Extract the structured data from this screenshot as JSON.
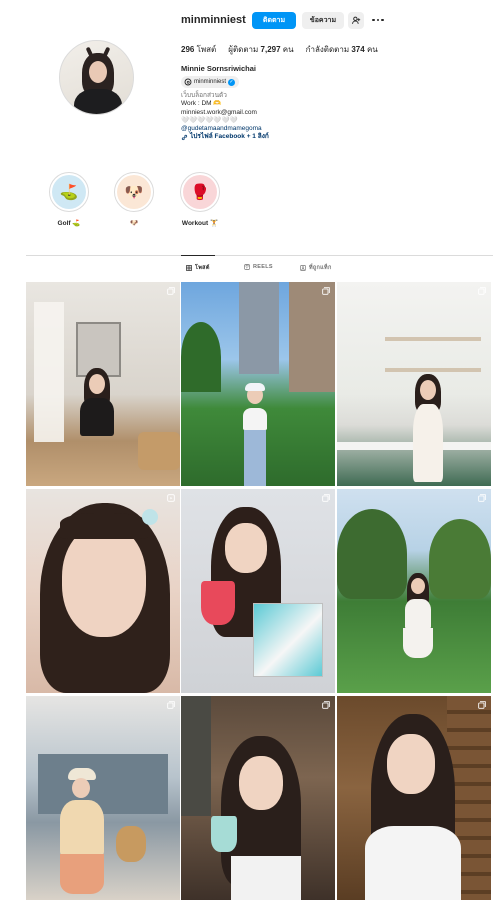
{
  "profile": {
    "username": "minminniest",
    "follow_label": "ติดตาม",
    "message_label": "ข้อความ",
    "posts_count": "296",
    "posts_label": "โพสต์",
    "followers_label": "ผู้ติดตาม",
    "followers_count": "7,297",
    "followers_unit": "คน",
    "following_label": "กำลังติดตาม",
    "following_count": "374",
    "following_unit": "คน",
    "full_name": "Minnie Sornsriwichai",
    "threads_handle": "minminniest",
    "category": "เว็บบล็อกส่วนตัว",
    "bio_lines": [
      "Work : DM 🫶",
      "minniest.work@gmail.com",
      "🤍🤍🤍🤍🤍🤍🤍"
    ],
    "mention": "@gudetamaandmamegoma",
    "links_text": "ไปรไฟล์ Facebook + 1 ลิงก์"
  },
  "highlights": [
    {
      "label": "Golf ⛳",
      "emoji": "⛳"
    },
    {
      "label": "🐶",
      "emoji": "🐶"
    },
    {
      "label": "Workout 🏋",
      "emoji": "🥊"
    }
  ],
  "tabs": {
    "posts": "โพสต์",
    "reels": "REELS",
    "tagged": "ที่ถูกแท็ก"
  },
  "posts": [
    {
      "type": "carousel"
    },
    {
      "type": "carousel"
    },
    {
      "type": "carousel"
    },
    {
      "type": "reel"
    },
    {
      "type": "carousel"
    },
    {
      "type": "carousel"
    },
    {
      "type": "carousel"
    },
    {
      "type": "carousel"
    },
    {
      "type": "carousel"
    }
  ],
  "colors": {
    "accent": "#0095f6",
    "text": "#262626",
    "muted": "#737373",
    "border": "#dbdbdb"
  }
}
